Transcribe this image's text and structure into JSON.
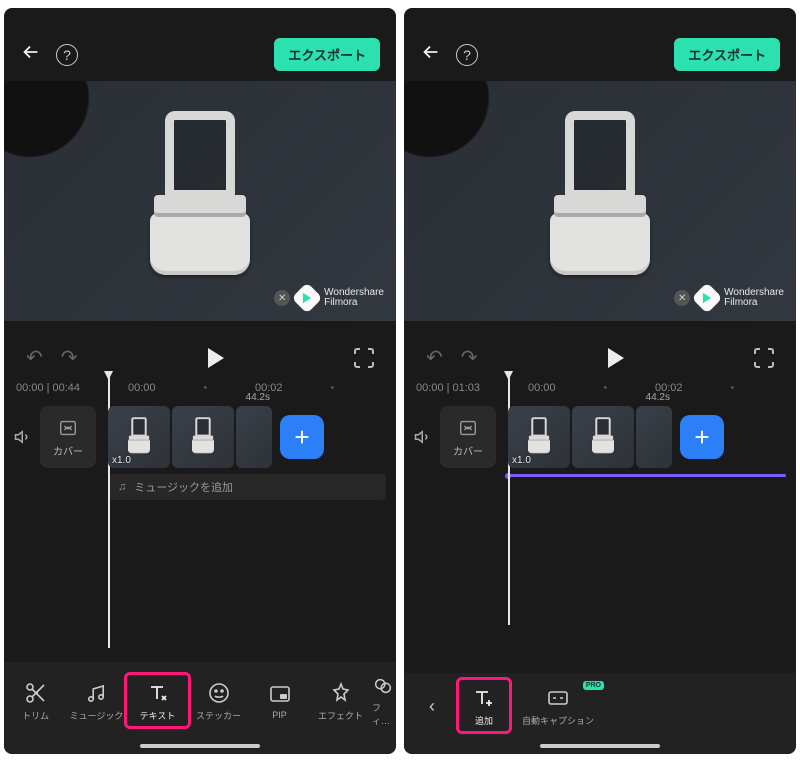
{
  "left": {
    "export_label": "エクスポート",
    "watermark_line1": "Wondershare",
    "watermark_line2": "Filmora",
    "timecode": "00:00 | 00:44",
    "ruler": {
      "t1": "00:00",
      "t2": "00:02"
    },
    "cover_label": "カバー",
    "clip_duration": "44.2s",
    "clip_speed": "x1.0",
    "music_add": "ミュージックを追加",
    "tools": {
      "trim": "トリム",
      "music": "ミュージック",
      "text": "テキスト",
      "sticker": "ステッカー",
      "pip": "PIP",
      "effect": "エフェクト",
      "filter": "フィ…"
    }
  },
  "right": {
    "export_label": "エクスポート",
    "watermark_line1": "Wondershare",
    "watermark_line2": "Filmora",
    "timecode": "00:00 | 01:03",
    "ruler": {
      "t1": "00:00",
      "t2": "00:02"
    },
    "cover_label": "カバー",
    "clip_duration": "44.2s",
    "clip_speed": "x1.0",
    "tools": {
      "add": "追加",
      "autocaption": "自動キャプション",
      "pro_badge": "PRO"
    }
  }
}
